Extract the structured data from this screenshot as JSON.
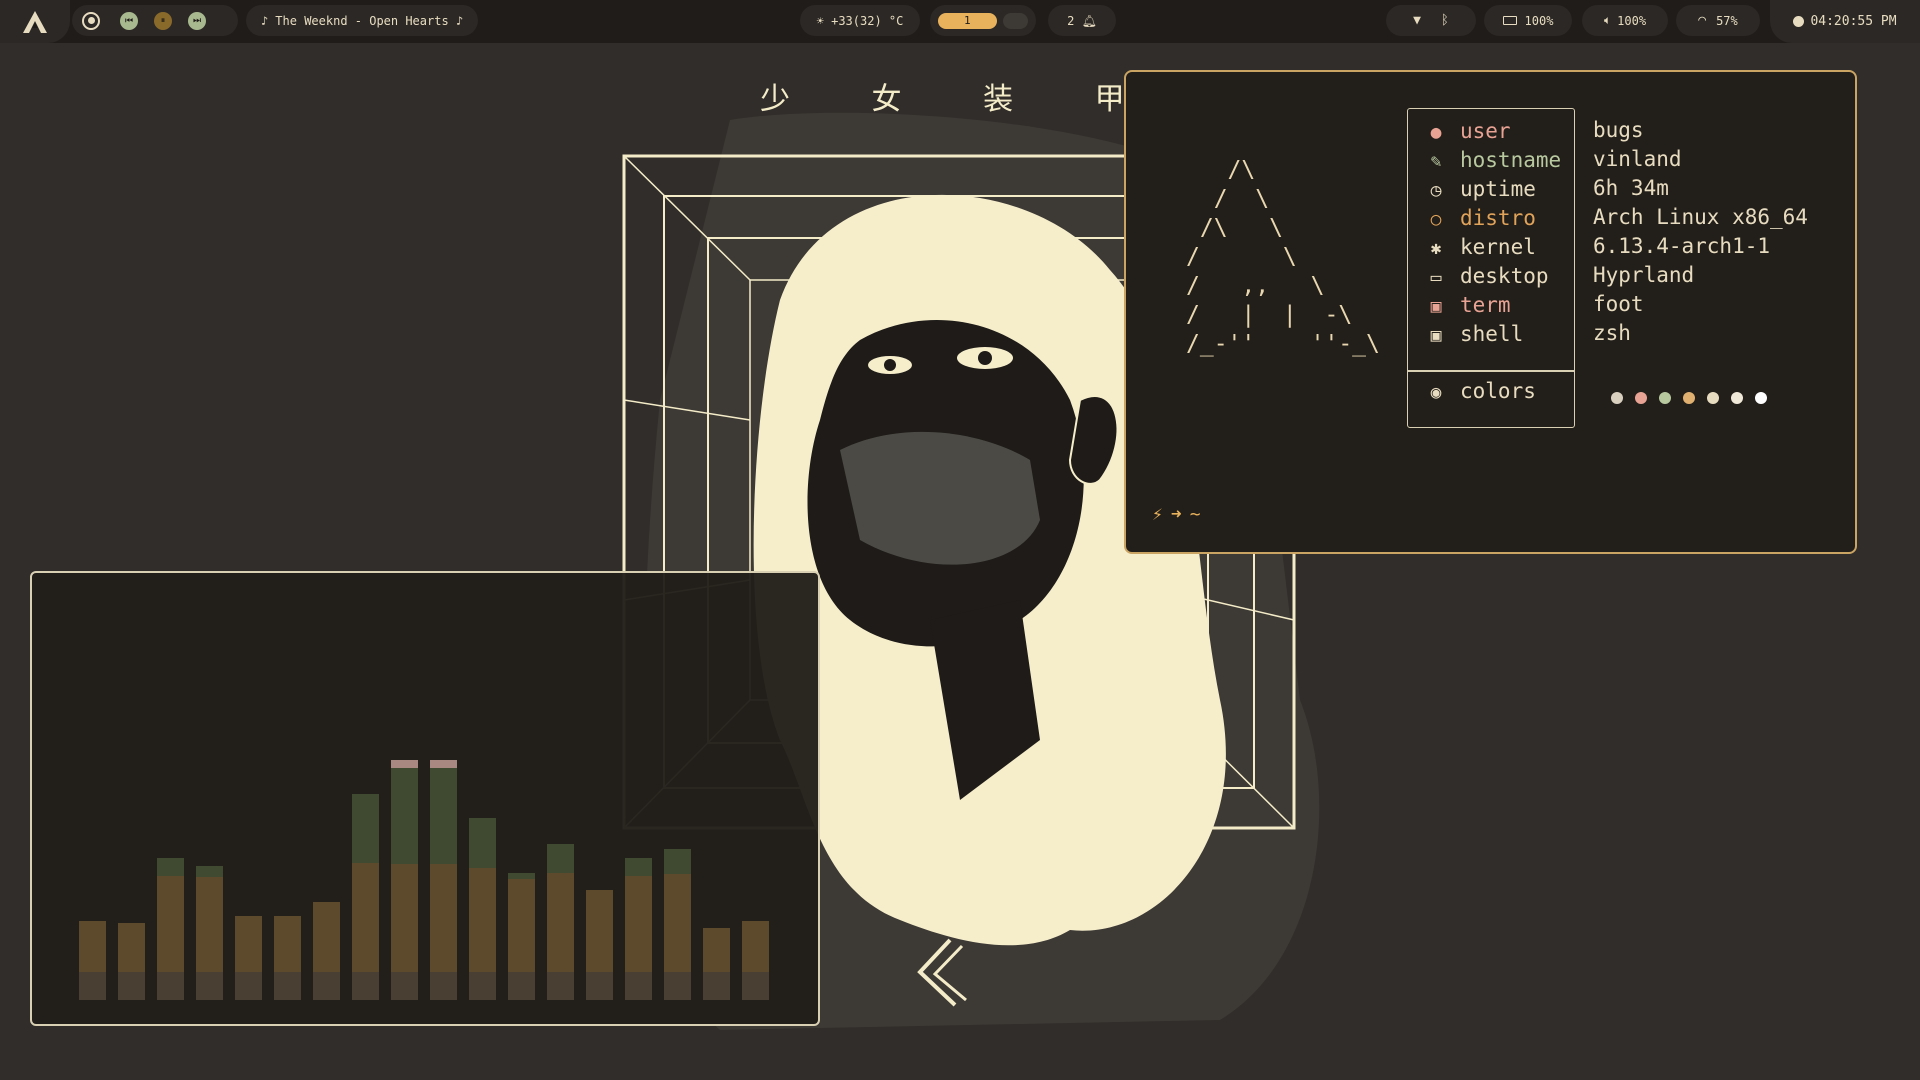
{
  "topbar": {
    "logo_icon": "arch-logo-icon",
    "media": {
      "record_icon": "record-icon",
      "prev_icon": "skip-previous-icon",
      "pause_icon": "pause-icon",
      "next_icon": "skip-next-icon",
      "now_playing": "♪ The Weeknd - Open Hearts ♪"
    },
    "weather": {
      "text": "☀ +33(32) °C"
    },
    "workspaces": {
      "active": "1"
    },
    "notifications": {
      "text": "2 🔔︎"
    },
    "tray": {
      "wifi_icon": "wifi-icon",
      "bluetooth_icon": "bluetooth-icon"
    },
    "battery": {
      "text": "100%"
    },
    "volume": {
      "text": "100%"
    },
    "network": {
      "text": "57%"
    },
    "clock": {
      "text": "04:20:55 PM"
    }
  },
  "wallpaper": {
    "title": "少 女 装 甲 战 士"
  },
  "cava": {
    "bars": [
      0.33,
      0.32,
      0.59,
      0.56,
      0.35,
      0.35,
      0.41,
      0.86,
      1.0,
      1.0,
      0.76,
      0.53,
      0.65,
      0.46,
      0.59,
      0.63,
      0.3,
      0.33
    ],
    "peaks": [
      8,
      9
    ]
  },
  "fetch": {
    "ascii_logo": "   /\\\n  /  \\\n /\\   \\\n/      \\\n/   ,,   \\\n/   |  |  -\\\n/_-''    ''-_\\",
    "rows": [
      {
        "icon": "user-icon",
        "label": "user",
        "value": "bugs",
        "color": "#e8a394"
      },
      {
        "icon": "feather-icon",
        "label": "hostname",
        "value": "vinland",
        "color": "#b8c9a0"
      },
      {
        "icon": "clock-icon",
        "label": "uptime",
        "value": "6h 34m",
        "color": "#e8dcc0"
      },
      {
        "icon": "circle-icon",
        "label": "distro",
        "value": "Arch Linux x86_64",
        "color": "#e0a35a"
      },
      {
        "icon": "gear-icon",
        "label": "kernel",
        "value": "6.13.4-arch1-1",
        "color": "#e8dcc0"
      },
      {
        "icon": "monitor-icon",
        "label": "desktop",
        "value": "Hyprland",
        "color": "#e8dcc0"
      },
      {
        "icon": "terminal-icon",
        "label": "term",
        "value": "foot",
        "color": "#e8a394"
      },
      {
        "icon": "terminal-icon",
        "label": "shell",
        "value": "zsh",
        "color": "#e8dcc0"
      }
    ],
    "colors_row": {
      "icon": "palette-icon",
      "label": "colors"
    },
    "palette": [
      "#d9d0c0",
      "#e8a394",
      "#b8c9a0",
      "#e0b070",
      "#e8dcc0",
      "#f0e8d8",
      "#ffffff"
    ],
    "prompt": {
      "bolt": "⚡",
      "arrow": "➜",
      "dir": "~"
    }
  }
}
